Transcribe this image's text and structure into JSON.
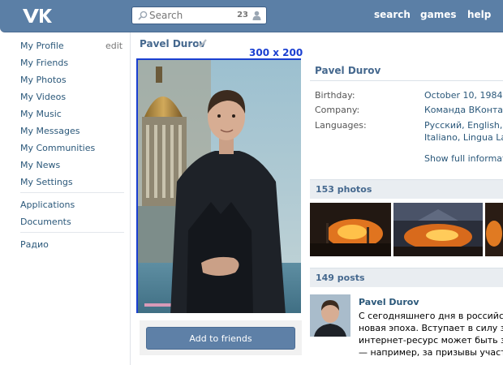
{
  "header": {
    "search_placeholder": "Search",
    "search_count": "23",
    "nav": [
      "search",
      "games",
      "help"
    ]
  },
  "sidebar": {
    "items": [
      "My Profile",
      "My Friends",
      "My Photos",
      "My Videos",
      "My Music",
      "My Messages",
      "My Communities",
      "My News",
      "My Settings"
    ],
    "edit_label": "edit",
    "apps": [
      "Applications",
      "Documents"
    ],
    "extra": [
      "Радио"
    ]
  },
  "profile": {
    "name": "Pavel Durov",
    "photo_size_label": "300 x 200",
    "add_friends_label": "Add to friends"
  },
  "info": {
    "name": "Pavel Durov",
    "birthday_label": "Birthday:",
    "birthday_value": "October 10, 1984",
    "company_label": "Company:",
    "company_value": "Команда ВКонтакте",
    "languages_label": "Languages:",
    "languages_line1": "Русский, English, Fra",
    "languages_line2": "Italiano, Lingua Latin",
    "show_full": "Show full information"
  },
  "photos_section": {
    "title": "153 photos"
  },
  "posts_section": {
    "title": "149 posts",
    "author": "Pavel Durov",
    "text_lines": [
      "С сегодняшнего дня в российском и",
      "новая эпоха. Вступает в силу закон,",
      "интернет-ресурс может быть забло",
      "— например, за призывы участвова"
    ]
  },
  "colors": {
    "header": "#5b7fa6",
    "link": "#2b587a",
    "accent": "#45688e",
    "annotation": "#1a3fd1"
  }
}
